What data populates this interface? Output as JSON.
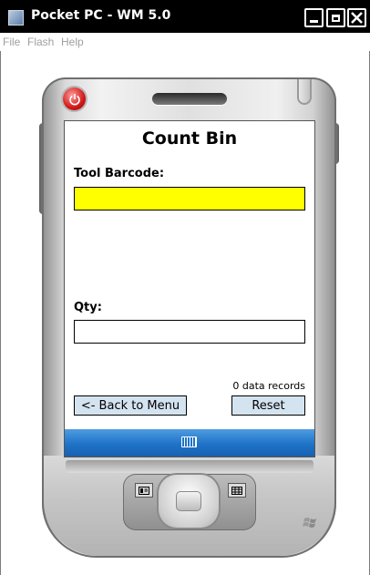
{
  "window": {
    "title": "Pocket PC - WM 5.0",
    "menu": [
      "File",
      "Flash",
      "Help"
    ],
    "controls": [
      "minimize-icon",
      "maximize-icon",
      "close-icon"
    ]
  },
  "screen": {
    "title": "Count Bin",
    "barcode": {
      "label": "Tool Barcode:",
      "value": "",
      "background": "#ffff00"
    },
    "qty": {
      "label": "Qty:",
      "value": ""
    },
    "records": "0 data records",
    "back_button": "<- Back to Menu",
    "reset_button": "Reset",
    "button_color": "#d4e3f0",
    "taskbar_icon": "keyboard-icon",
    "taskbar_color": "#1e73c8"
  },
  "device": {
    "icons": [
      "power-icon",
      "softkey-left-icon",
      "softkey-right-icon",
      "windows-logo-icon"
    ]
  }
}
